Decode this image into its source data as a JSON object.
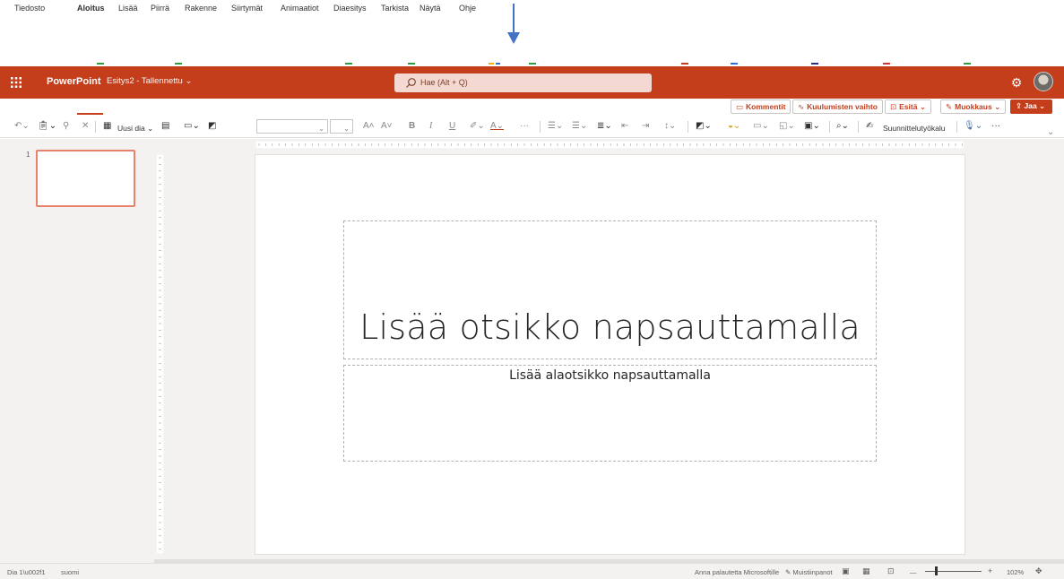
{
  "app": {
    "name": "PowerPoint",
    "document": "Esitys2 - Tallennettu",
    "search_placeholder": "Hae (Alt + Q)"
  },
  "menu": {
    "tabs": [
      "Tiedosto",
      "Aloitus",
      "Lisää",
      "Piirrä",
      "Rakenne",
      "Siirtymät",
      "Animaatiot",
      "Diaesitys",
      "Tarkista",
      "Näytä",
      "Ohje"
    ],
    "active_tab": "Aloitus"
  },
  "ribbon_buttons": {
    "comments": "Kommentit",
    "catch_up": "Kuulumisten vaihto",
    "present": "Esitä",
    "editing": "Muokkaus",
    "share": "Jaa"
  },
  "toolbar": {
    "new_slide": "Uusi dia",
    "designer": "Suunnittelutyökalu",
    "more": "···"
  },
  "slides": {
    "current_number": "1",
    "title_placeholder": "Lisää otsikko napsauttamalla",
    "subtitle_placeholder": "Lisää alaotsikko napsauttamalla"
  },
  "status": {
    "slide_info": "Dia 1\\u002f1",
    "language": "suomi",
    "feedback": "Anna palautetta Microsoftille",
    "notes": "Muistiinpanot",
    "zoom_minus": "—",
    "zoom_plus": "+",
    "zoom": "102%"
  },
  "colors": {
    "accent": "#c43e1c",
    "pane_bg": "#f3f2f1",
    "arrow": "#4472c4"
  }
}
